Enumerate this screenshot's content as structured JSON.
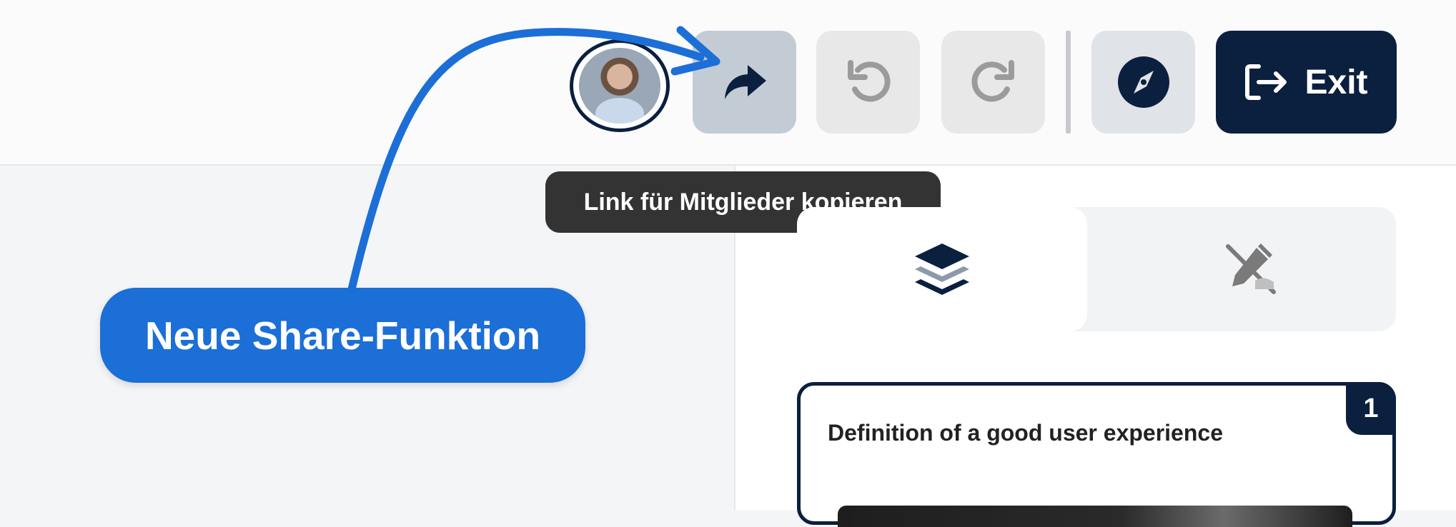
{
  "toolbar": {
    "avatar_alt": "User avatar",
    "share_icon": "share-arrow-icon",
    "undo_icon": "undo-icon",
    "redo_icon": "redo-icon",
    "navigate_icon": "compass-icon",
    "exit_label": "Exit",
    "exit_icon": "logout-icon"
  },
  "tooltip": {
    "text": "Link für Mitglieder kopieren"
  },
  "panel": {
    "tabs": [
      {
        "icon": "layers-icon",
        "active": true
      },
      {
        "icon": "edit-off-icon",
        "active": false
      }
    ],
    "card": {
      "number": "1",
      "title": "Definition of a good user experience"
    }
  },
  "annotation": {
    "label": "Neue Share-Funktion"
  },
  "colors": {
    "navy": "#0b1f3f",
    "callout_blue": "#1b6fd6",
    "share_button_bg": "#c3ccd5",
    "tooltip_bg": "#333333"
  }
}
